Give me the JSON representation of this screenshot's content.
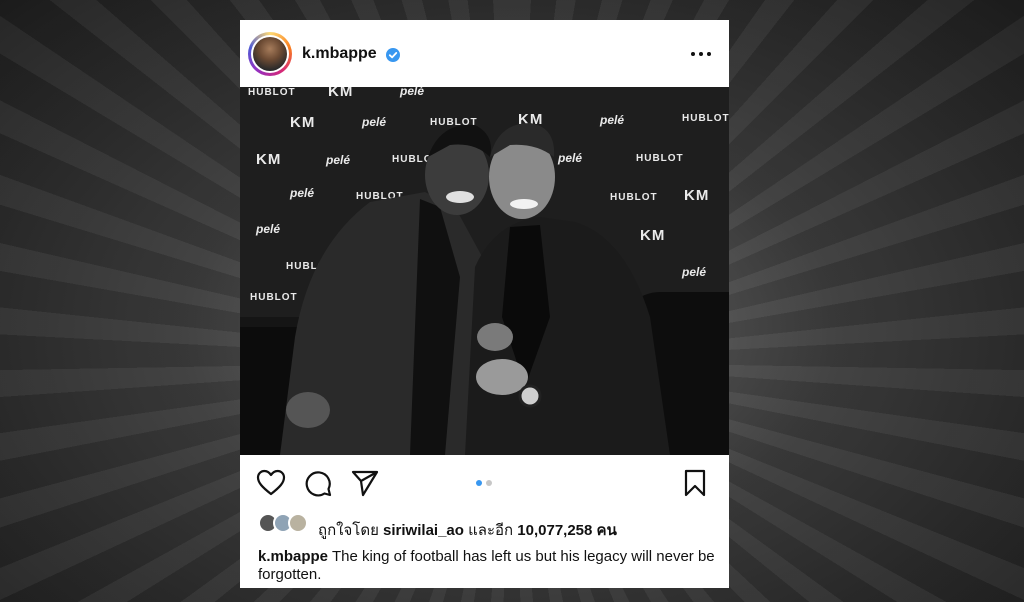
{
  "post": {
    "username": "k.mbappe",
    "verified": true,
    "avatar_alt": "profile picture",
    "more_icon": "more-horizontal-icon",
    "photo_wall_text": {
      "km": "KM",
      "pele": "pelé",
      "hublot": "HUBLOT"
    },
    "carousel": {
      "count": 2,
      "active_index": 0
    },
    "actions": {
      "like_icon": "heart-icon",
      "comment_icon": "comment-icon",
      "share_icon": "send-icon",
      "save_icon": "bookmark-icon"
    },
    "likes": {
      "prefix": "ถูกใจโดย",
      "first_liker": "siriwilai_ao",
      "middle": "และอีก",
      "count": "10,077,258",
      "suffix": "คน"
    },
    "caption": {
      "username": "k.mbappe",
      "text": "The king of football has left us but his legacy will never be forgotten."
    }
  },
  "colors": {
    "verified": "#3897f0",
    "carousel_active": "#3897f0",
    "carousel_inactive": "#c7c7c7"
  }
}
